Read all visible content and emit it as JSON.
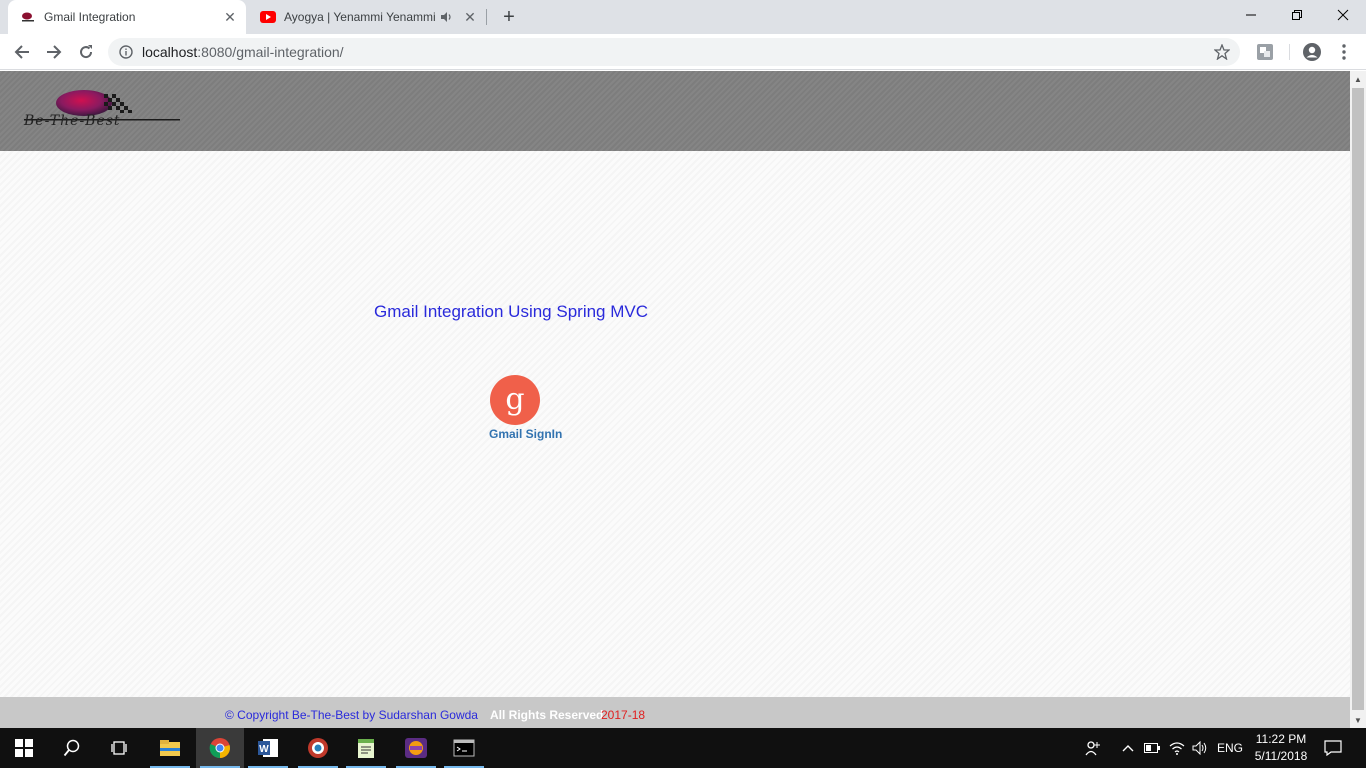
{
  "browser": {
    "tabs": [
      {
        "title": "Gmail Integration",
        "active": true,
        "favicon": "be-the-best-logo"
      },
      {
        "title": "Ayogya | Yenammi Yenammi",
        "active": false,
        "favicon": "youtube-icon",
        "playing_audio": true
      }
    ],
    "url_host": "localhost",
    "url_rest": ":8080/gmail-integration/"
  },
  "page": {
    "logo_text": "Be-The-Best",
    "heading": "Gmail Integration Using Spring MVC",
    "signin_glyph": "g",
    "signin_label": "Gmail SignIn",
    "footer": {
      "copyright": "© Copyright Be-The-Best by Sudarshan Gowda",
      "rights": "All Rights Reserved",
      "years": "2017-18"
    }
  },
  "taskbar": {
    "apps": [
      "start",
      "search",
      "task-view",
      "file-explorer",
      "chrome",
      "word",
      "app-red",
      "notepad-plus",
      "app-games",
      "terminal"
    ],
    "language": "ENG",
    "time": "11:22 PM",
    "date": "5/11/2018"
  },
  "colors": {
    "heading": "#2a2adb",
    "signin_bg": "#f0604a",
    "signin_label": "#3273b0",
    "years": "#e02020"
  }
}
